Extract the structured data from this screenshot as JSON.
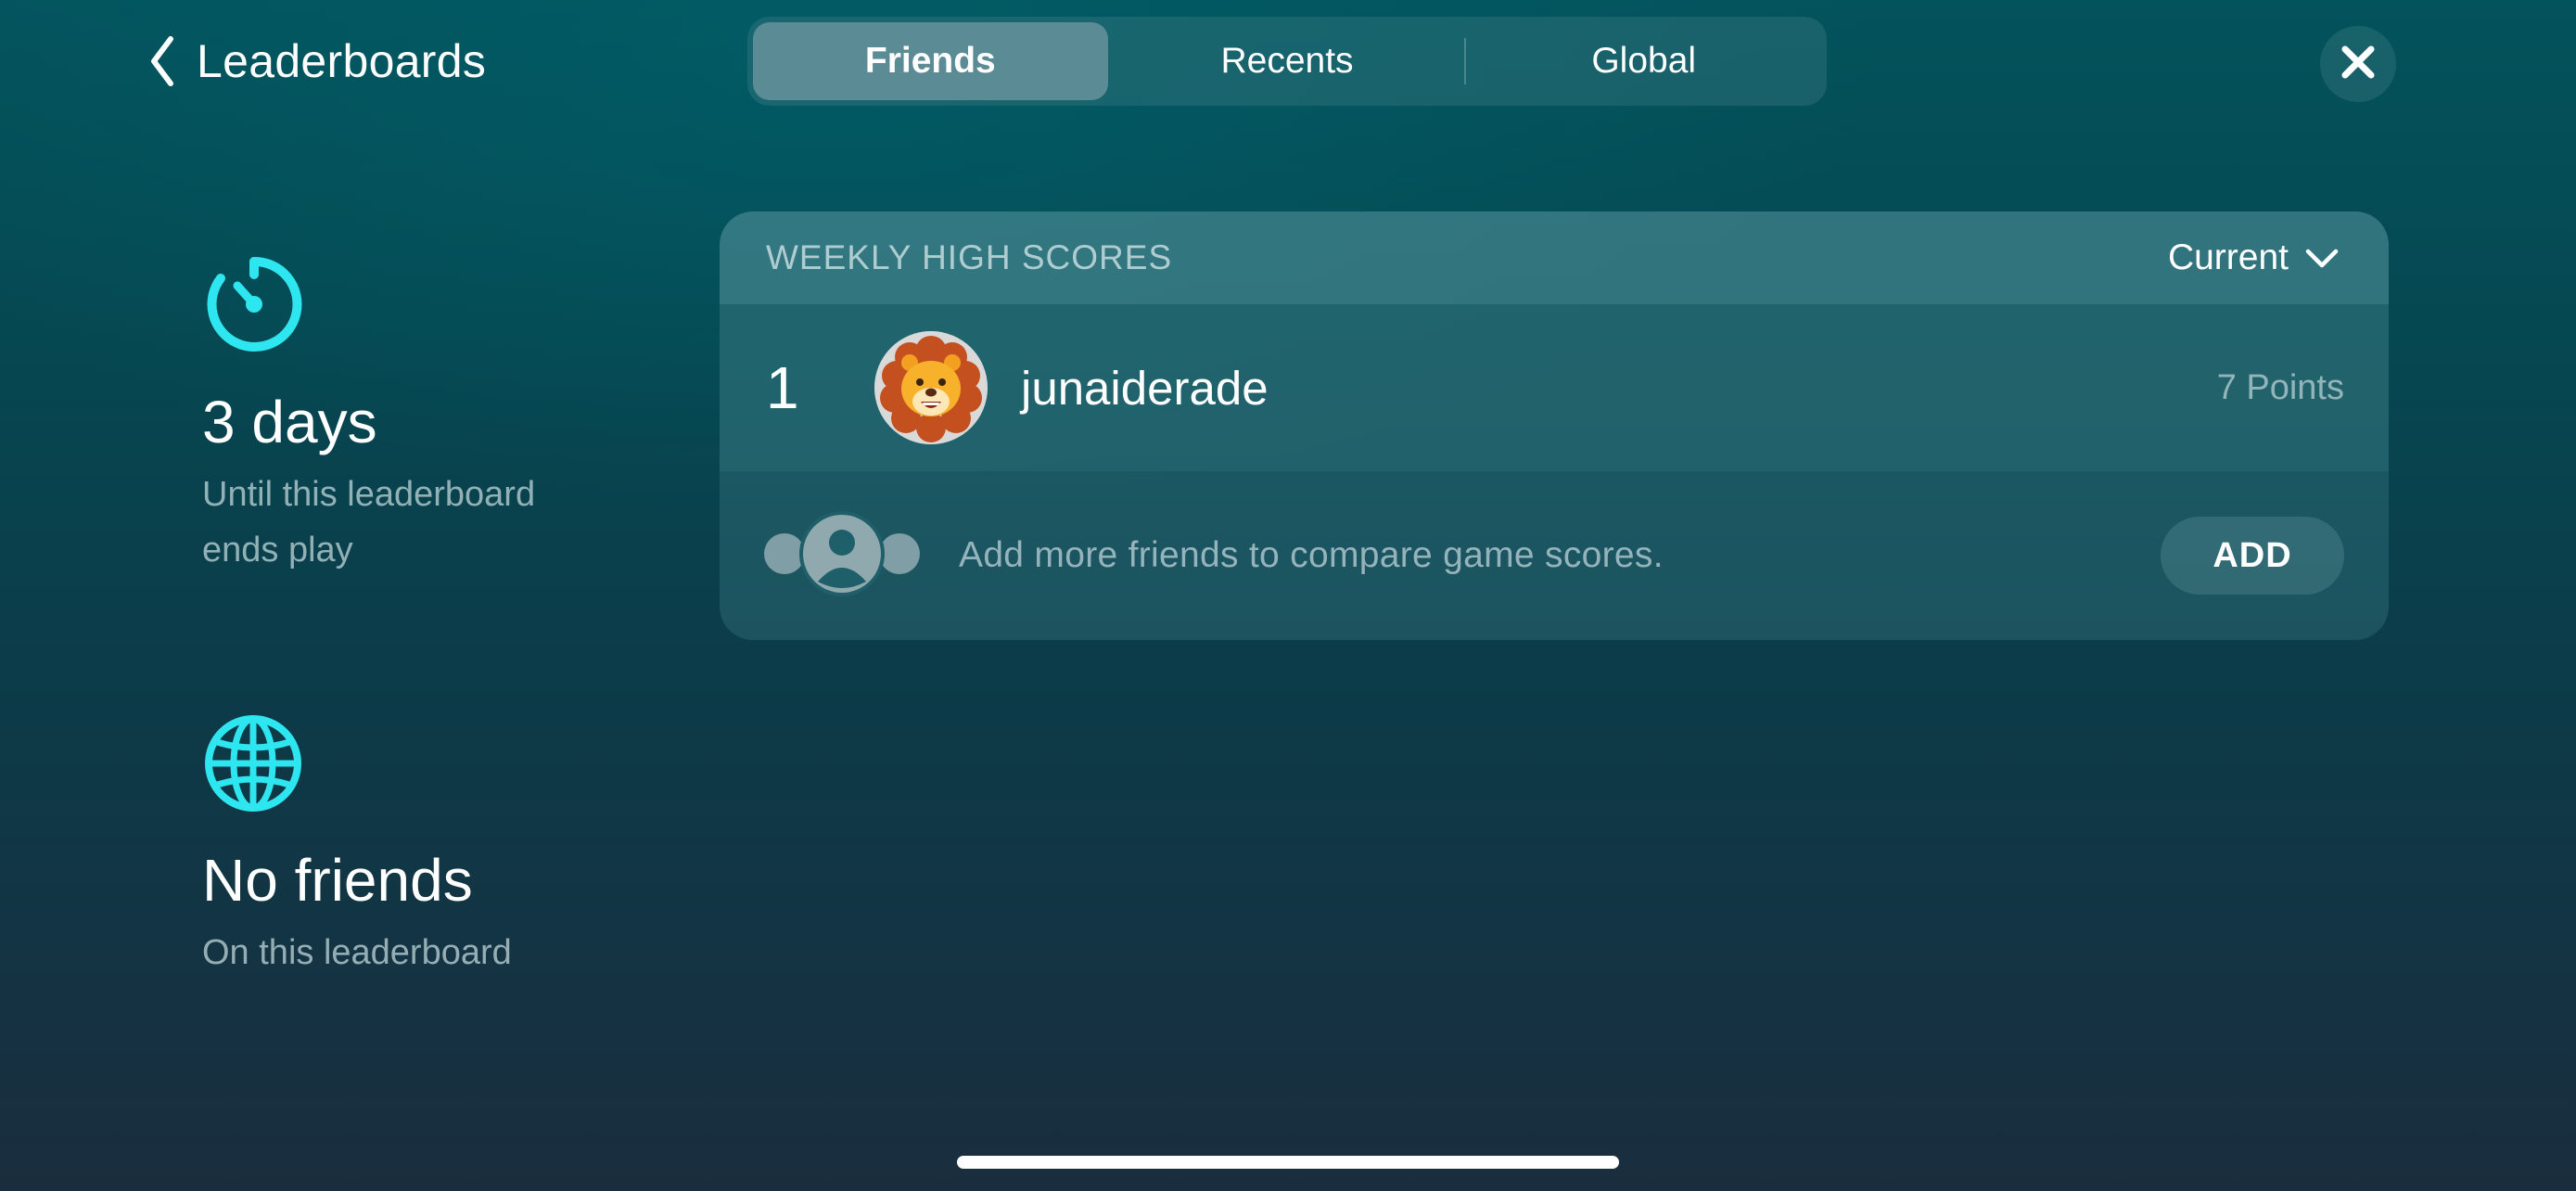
{
  "colors": {
    "accent": "#2ee6ef",
    "background_top": "#03535c",
    "background_bottom": "#1a2d3e",
    "segment_active": "#5b8b95"
  },
  "nav": {
    "back_icon": "chevron-left-icon",
    "back_label": "Leaderboards",
    "close_icon": "xmark-icon"
  },
  "tabs": [
    {
      "label": "Friends",
      "selected": true
    },
    {
      "label": "Recents",
      "selected": false
    },
    {
      "label": "Global",
      "selected": false
    }
  ],
  "info": {
    "timer": {
      "icon": "timer-icon",
      "title": "3 days",
      "subtitle_line1": "Until this leaderboard",
      "subtitle_line2": "ends play"
    },
    "friends": {
      "icon": "globe-icon",
      "title": "No friends",
      "subtitle": "On this leaderboard"
    }
  },
  "scores": {
    "title": "WEEKLY HIGH SCORES",
    "period": "Current",
    "period_icon": "chevron-down-icon",
    "entries": [
      {
        "rank": "1",
        "avatar": "lion-memoji-avatar",
        "name": "junaiderade",
        "points": "7 Points"
      }
    ],
    "add_prompt": {
      "icon": "friends-group-icon",
      "text": "Add more friends to compare game scores.",
      "button": "ADD"
    }
  }
}
